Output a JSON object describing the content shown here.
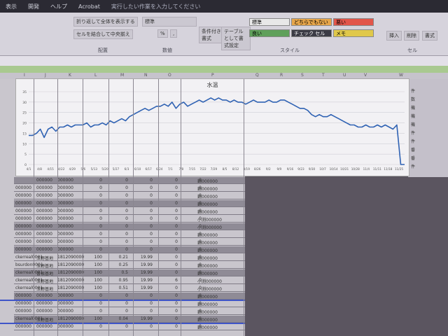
{
  "menu": {
    "items": [
      "表示",
      "開発",
      "ヘルプ",
      "Acrobat"
    ],
    "tell_me": "実行したい作業を入力してください"
  },
  "ribbon": {
    "wrap_text": "折り返して全体を表示する",
    "merge_center": "セルを結合して中央揃え",
    "number_format": "標準",
    "percent": "%",
    "comma": ",",
    "cond_format": "条件付き書式",
    "table_format": "テーブルとして書式設定",
    "groups": {
      "alignment": "配置",
      "number": "数値",
      "styles": "スタイル",
      "cells": "セル"
    },
    "styles": {
      "normal": "標準",
      "neutral": "どちらでもない",
      "bad": "悪い",
      "good": "良い",
      "check": "チェック セル",
      "memo": "メモ"
    },
    "cells": {
      "insert": "挿入",
      "delete": "削除",
      "format": "書式"
    },
    "colors": {
      "bad": "#e2554a",
      "neutral": "#e7a64a",
      "good": "#5fa05a",
      "check": "#3b3b45",
      "memo": "#e0c84a",
      "normal": "#e8e8e8"
    }
  },
  "column_headers": [
    "I",
    "J",
    "K",
    "L",
    "M",
    "N",
    "O",
    "P",
    "Q",
    "R",
    "S",
    "T",
    "U",
    "V",
    "W"
  ],
  "chart_data": {
    "type": "line",
    "title": "水温",
    "x_ticks": [
      "4/1",
      "4/8",
      "4/15",
      "4/22",
      "4/29",
      "5/6",
      "5/13",
      "5/20",
      "5/27",
      "6/3",
      "6/10",
      "6/17",
      "6/24",
      "7/1",
      "7/8",
      "7/15",
      "7/22",
      "7/29",
      "8/5",
      "8/12",
      "8/19",
      "8/26",
      "9/2",
      "9/9",
      "9/16",
      "9/23",
      "9/30",
      "10/7",
      "10/14",
      "10/21",
      "10/28",
      "11/4",
      "11/11",
      "11/18",
      "11/25"
    ],
    "y_ticks": [
      "35",
      "30",
      "25",
      "20",
      "15",
      "10",
      "5",
      "0"
    ],
    "ylim": [
      0,
      35
    ],
    "series": [
      {
        "color": "#2f62b3",
        "values": [
          14,
          14,
          15,
          17,
          13,
          17,
          18,
          16,
          18,
          18,
          19,
          18,
          19,
          19,
          19,
          20,
          18,
          19,
          19,
          20,
          19,
          21,
          20,
          21,
          22,
          21,
          23,
          24,
          25,
          26,
          27,
          26,
          27,
          28,
          28,
          29,
          28,
          30,
          27,
          29,
          30,
          28,
          29,
          30,
          31,
          30,
          31,
          32,
          31,
          32,
          31,
          31,
          30,
          31,
          30,
          30,
          29,
          30,
          31,
          30,
          30,
          30,
          31,
          30,
          30,
          31,
          31,
          30,
          29,
          28,
          27,
          27,
          26,
          24,
          23,
          24,
          23,
          23,
          24,
          23,
          22,
          21,
          20,
          19,
          19,
          18,
          18,
          19,
          18,
          18,
          19,
          18,
          19,
          18,
          17,
          19,
          0,
          0
        ]
      }
    ]
  },
  "sheet_rows": [
    {
      "a": "",
      "b": "000000",
      "c": "000000",
      "d": "0",
      "e": "0",
      "f": "0",
      "g": "0",
      "h": "0",
      "i": "鋼000000"
    },
    {
      "a": "000000",
      "b": "000000",
      "c": "000000",
      "d": "0",
      "e": "0",
      "f": "0",
      "g": "0",
      "h": "0",
      "i": "鋼000000"
    },
    {
      "a": "000000",
      "b": "000000",
      "c": "000000",
      "d": "0",
      "e": "0",
      "f": "0",
      "g": "0",
      "h": "0",
      "i": "鋼000000"
    },
    {
      "a": "000000",
      "b": "000000",
      "c": "000000",
      "d": "0",
      "e": "0",
      "f": "0",
      "g": "0",
      "h": "0",
      "i": "鋼000000"
    },
    {
      "a": "000000",
      "b": "000000",
      "c": "000000",
      "d": "0",
      "e": "0",
      "f": "0",
      "g": "0",
      "h": "0",
      "i": "鋼000000"
    },
    {
      "a": "000000",
      "b": "000000",
      "c": "000000",
      "d": "0",
      "e": "0",
      "f": "0",
      "g": "0",
      "h": "0",
      "i": "小渕000000"
    },
    {
      "a": "000000",
      "b": "000000",
      "c": "000000",
      "d": "0",
      "e": "0",
      "f": "0",
      "g": "0",
      "h": "0",
      "i": "小渕000000"
    },
    {
      "a": "000000",
      "b": "000000",
      "c": "000000",
      "d": "0",
      "e": "0",
      "f": "0",
      "g": "0",
      "h": "0",
      "i": "鋼000000"
    },
    {
      "a": "000000",
      "b": "000000",
      "c": "000000",
      "d": "0",
      "e": "0",
      "f": "0",
      "g": "0",
      "h": "0",
      "i": "鋼000000"
    },
    {
      "a": "000000",
      "b": "000000",
      "c": "000000",
      "d": "0",
      "e": "0",
      "f": "0",
      "g": "0",
      "h": "0",
      "i": "鋼000000"
    },
    {
      "a": "ckerreal0001",
      "b": "玉野基地",
      "c": "1812090000",
      "d": "100",
      "e": "0.21",
      "f": "19.99",
      "g": "0",
      "h": "0",
      "i": "鋼000000"
    },
    {
      "a": "bsurdon0001",
      "b": "玉野基地",
      "c": "1812090000",
      "d": "100",
      "e": "0.25",
      "f": "19.99",
      "g": "0",
      "h": "0",
      "i": "鋼000000"
    },
    {
      "a": "ckerreal0001",
      "b": "曽根基地",
      "c": "1812090000",
      "d": "100",
      "e": "0.5",
      "f": "19.99",
      "g": "0",
      "h": "0",
      "i": "鋼000000"
    },
    {
      "a": "ckerreal0001",
      "b": "玉野基地",
      "c": "1812090000",
      "d": "100",
      "e": "0.95",
      "f": "19.99",
      "g": "6",
      "h": "0",
      "i": "小渕000000"
    },
    {
      "a": "ckerreal0001",
      "b": "玉野基地",
      "c": "1812090000",
      "d": "100",
      "e": "0.51",
      "f": "19.99",
      "g": "0",
      "h": "0",
      "i": "小渕000000"
    },
    {
      "a": "000000",
      "b": "000000",
      "c": "000000",
      "d": "0",
      "e": "0",
      "f": "0",
      "g": "0",
      "h": "0",
      "i": "鋼000000"
    },
    {
      "a": "000000",
      "b": "000000",
      "c": "000000",
      "d": "0",
      "e": "0",
      "f": "0",
      "g": "0",
      "h": "0",
      "i": "鋼000000"
    },
    {
      "a": "000000",
      "b": "000000",
      "c": "000000",
      "d": "0",
      "e": "0",
      "f": "0",
      "g": "0",
      "h": "0",
      "i": "鋼000000"
    },
    {
      "a": "ckerreal0001",
      "b": "玉野基地",
      "c": "1812090000",
      "d": "100",
      "e": "0.04",
      "f": "19.99",
      "g": "0",
      "h": "0",
      "i": "鋼000000"
    },
    {
      "a": "000000",
      "b": "000000",
      "c": "000000",
      "d": "0",
      "e": "0",
      "f": "0",
      "g": "0",
      "h": "0",
      "i": "鋼000000"
    }
  ],
  "right_panel": [
    "件",
    "数",
    "機",
    "機",
    "機",
    "件",
    "件",
    "番",
    "番",
    "件"
  ]
}
